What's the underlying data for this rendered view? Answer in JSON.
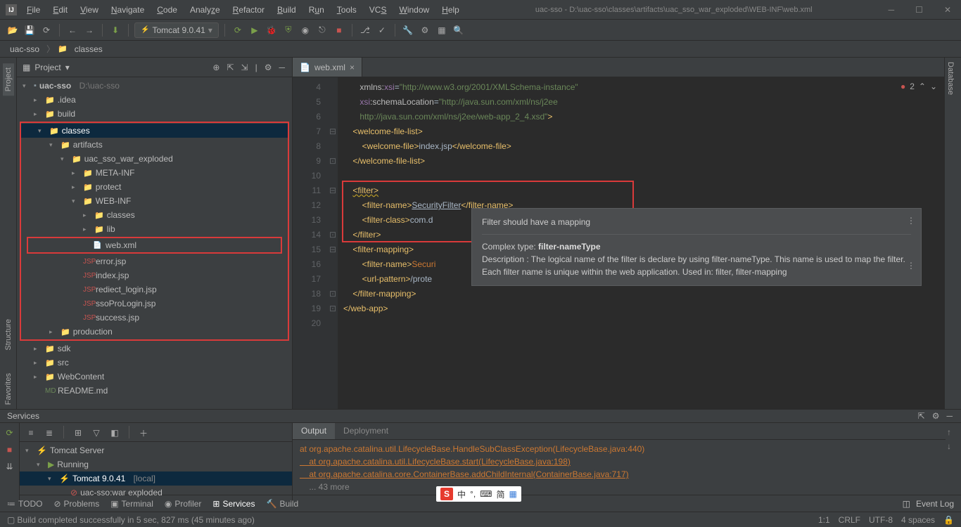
{
  "title_path": "uac-sso - D:\\uac-sso\\classes\\artifacts\\uac_sso_war_exploded\\WEB-INF\\web.xml",
  "menu": [
    "File",
    "Edit",
    "View",
    "Navigate",
    "Code",
    "Analyze",
    "Refactor",
    "Build",
    "Run",
    "Tools",
    "VCS",
    "Window",
    "Help"
  ],
  "run_config": "Tomcat 9.0.41",
  "breadcrumbs": [
    "uac-sso",
    "classes"
  ],
  "panel_title": "Project",
  "tree": {
    "root": {
      "name": "uac-sso",
      "path": "D:\\uac-sso"
    },
    "idea": ".idea",
    "build": "build",
    "classes": "classes",
    "artifacts": "artifacts",
    "exploded": "uac_sso_war_exploded",
    "meta": "META-INF",
    "protect": "protect",
    "webinf": "WEB-INF",
    "classes2": "classes",
    "lib": "lib",
    "webxml": "web.xml",
    "errorjsp": "error.jsp",
    "indexjsp": "index.jsp",
    "redirect": "rediect_login.jsp",
    "ssopro": "ssoProLogin.jsp",
    "success": "success.jsp",
    "production": "production",
    "sdk": "sdk",
    "src": "src",
    "webcontent": "WebContent",
    "readme": "README.md"
  },
  "tab_name": "web.xml",
  "gutter_lines": [
    "4",
    "5",
    "6",
    "7",
    "8",
    "9",
    "10",
    "11",
    "12",
    "13",
    "14",
    "15",
    "16",
    "17",
    "18",
    "19",
    "20"
  ],
  "code": {
    "l4_attr": "xmlns:",
    "l4_ns": "xsi",
    "l4_eq": "=",
    "l4_str": "\"http://www.w3.org/2001/XMLSchema-instance\"",
    "l5_ns": "xsi",
    "l5_attr": ":schemaLocation",
    "l5_eq": "=",
    "l5_str": "\"http://java.sun.com/xml/ns/j2ee",
    "l6_str": "http://java.sun.com/xml/ns/j2ee/web-app_2_4.xsd\"",
    "l6_close": ">",
    "l7": "<welcome-file-list>",
    "l8_open": "<welcome-file>",
    "l8_text": "index.jsp",
    "l8_close": "</welcome-file>",
    "l9": "</welcome-file-list>",
    "l11": "<filter>",
    "l12_open": "<filter-name>",
    "l12_text": "SecurityFilter",
    "l12_close": "</filter-name>",
    "l13_open": "<filter-class>",
    "l13_text": "com.d",
    "l14": "</filter>",
    "l15": "<filter-mapping>",
    "l16_open": "<filter-name>",
    "l16_text": "Securi",
    "l17_open": "<url-pattern>",
    "l17_text": "/prote",
    "l18": "</filter-mapping>",
    "l19": "</web-app>"
  },
  "err_count": "2",
  "tooltip": {
    "title": "Filter should have a mapping",
    "line2a": "Complex type: ",
    "line2b": "filter-nameType",
    "desc": "Description : The logical name of the filter is declare by using filter-nameType. This name is used to map the filter. Each filter name is unique within the web application. Used in: filter, filter-mapping"
  },
  "services": {
    "title": "Services",
    "tabs": [
      "Output",
      "Deployment"
    ],
    "tree_root": "Tomcat Server",
    "running": "Running",
    "instance": "Tomcat 9.0.41",
    "instance_suffix": "[local]",
    "artifact": "uac-sso:war exploded",
    "console": [
      "at org.apache.catalina.util.LifecycleBase.HandleSubClassException(LifecycleBase.java:440)",
      "    at org.apache.catalina.util.LifecycleBase.start(LifecycleBase.java:198)",
      "    at org.apache.catalina.core.ContainerBase.addChildInternal(ContainerBase.java:717)",
      "    ... 43 more"
    ]
  },
  "bottom_tabs": [
    "TODO",
    "Problems",
    "Terminal",
    "Profiler",
    "Services",
    "Build"
  ],
  "event_log": "Event Log",
  "status_msg": "Build completed successfully in 5 sec, 827 ms (45 minutes ago)",
  "status_right": {
    "pos": "1:1",
    "eol": "CRLF",
    "enc": "UTF-8",
    "indent": "4 spaces"
  },
  "sidebar": {
    "project": "Project",
    "structure": "Structure",
    "favorites": "Favorites",
    "database": "Database"
  },
  "ime": {
    "s": "S",
    "zhong": "中",
    "jian": "简"
  }
}
